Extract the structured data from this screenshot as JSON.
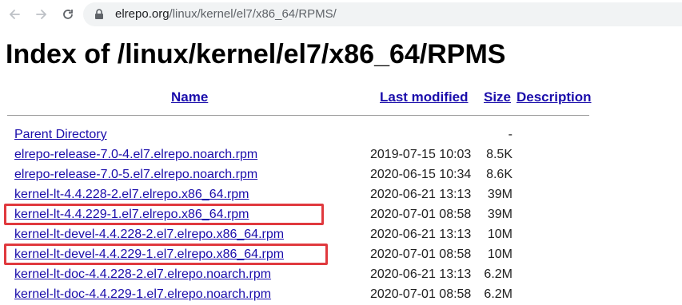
{
  "browser": {
    "url_host": "elrepo.org",
    "url_path": "/linux/kernel/el7/x86_64/RPMS/",
    "icons": {
      "back": "arrow-left-icon",
      "forward": "arrow-right-icon",
      "reload": "reload-icon",
      "security": "lock-icon"
    }
  },
  "page": {
    "title": "Index of /linux/kernel/el7/x86_64/RPMS",
    "columns": {
      "name": "Name",
      "last_modified": "Last modified",
      "size": "Size",
      "description": "Description"
    },
    "rows": [
      {
        "name": "Parent Directory",
        "date": "",
        "size": "-"
      },
      {
        "name": "elrepo-release-7.0-4.el7.elrepo.noarch.rpm",
        "date": "2019-07-15 10:03",
        "size": "8.5K"
      },
      {
        "name": "elrepo-release-7.0-5.el7.elrepo.noarch.rpm",
        "date": "2020-06-15 10:34",
        "size": "8.6K"
      },
      {
        "name": "kernel-lt-4.4.228-2.el7.elrepo.x86_64.rpm",
        "date": "2020-06-21 13:13",
        "size": "39M"
      },
      {
        "name": "kernel-lt-4.4.229-1.el7.elrepo.x86_64.rpm",
        "date": "2020-07-01 08:58",
        "size": "39M",
        "highlighted": true
      },
      {
        "name": "kernel-lt-devel-4.4.228-2.el7.elrepo.x86_64.rpm",
        "date": "2020-06-21 13:13",
        "size": "10M"
      },
      {
        "name": "kernel-lt-devel-4.4.229-1.el7.elrepo.x86_64.rpm",
        "date": "2020-07-01 08:58",
        "size": "10M",
        "highlighted": true
      },
      {
        "name": "kernel-lt-doc-4.4.228-2.el7.elrepo.noarch.rpm",
        "date": "2020-06-21 13:13",
        "size": "6.2M"
      },
      {
        "name": "kernel-lt-doc-4.4.229-1.el7.elrepo.noarch.rpm",
        "date": "2020-07-01 08:58",
        "size": "6.2M"
      }
    ]
  },
  "colors": {
    "link": "#1a0dab",
    "highlight_border": "#e0393e",
    "omnibox_bg": "#f1f3f4"
  }
}
